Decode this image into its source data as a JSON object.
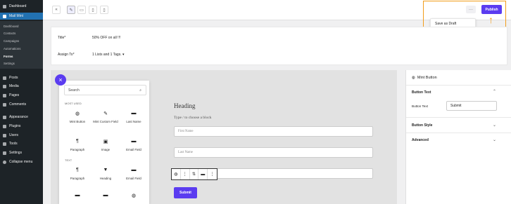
{
  "sidebar": {
    "menu": [
      {
        "label": "Dashboard"
      },
      {
        "label": "Mail Mint"
      },
      {
        "label": "Posts"
      },
      {
        "label": "Media"
      },
      {
        "label": "Pages"
      },
      {
        "label": "Comments"
      },
      {
        "label": "Appearance"
      },
      {
        "label": "Plugins"
      },
      {
        "label": "Users"
      },
      {
        "label": "Tools"
      },
      {
        "label": "Settings"
      },
      {
        "label": "Collapse menu"
      }
    ],
    "submenu": [
      "Dashboard",
      "Contacts",
      "Campaigns",
      "Automations",
      "Forms",
      "Settings"
    ]
  },
  "toolbar": {
    "publish": "Publish",
    "save_draft": "Save as Draft",
    "more": "···"
  },
  "meta": {
    "title_label": "Title*",
    "title_value": "50% OFF on all !!!",
    "assign_label": "Assign To*",
    "assign_value": "1 Lists and 1 Tags."
  },
  "inserter": {
    "search_placeholder": "Search",
    "most_used": "MOST USED",
    "text_section": "TEXT",
    "blocks": [
      "Mint Button",
      "Mint Custom Field",
      "Last Name",
      "Paragraph",
      "Image",
      "Email Field",
      "Paragraph",
      "Heading",
      "Email Field",
      "",
      "",
      ""
    ]
  },
  "canvas": {
    "heading": "Heading",
    "hint": "Type / to choose a block",
    "first_name": "First Name",
    "last_name": "Last Name",
    "submit": "Submit"
  },
  "panel": {
    "block_name": "Mint Button",
    "button_text_section": "Button Text",
    "button_text_label": "Button Text",
    "button_text_value": "Submit",
    "button_style": "Button Style",
    "advanced": "Advanced"
  },
  "colors": {
    "accent": "#5b3cf0",
    "highlight": "#f29d1b",
    "sidebar": "#1d2327"
  }
}
